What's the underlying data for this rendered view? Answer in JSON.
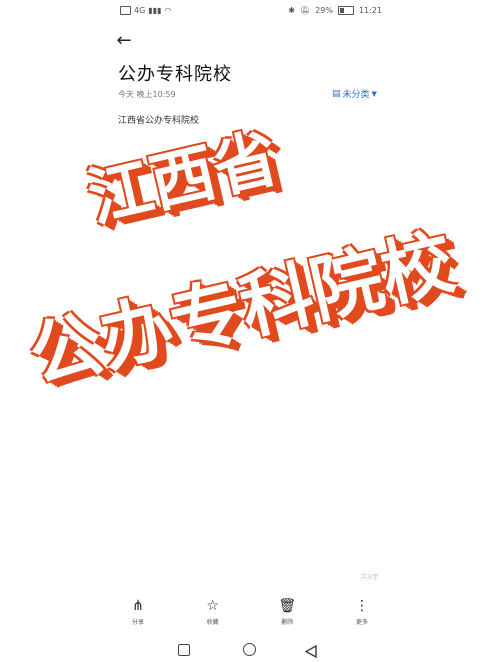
{
  "status_bar": {
    "left_icons": [
      "sim-icon",
      "signal-icon",
      "wifi-icon"
    ],
    "network": "4G",
    "battery_percent": "29%",
    "time": "11:21"
  },
  "header": {
    "title": "公办专科院校",
    "date": "今天 晚上10:59",
    "category": "未分类"
  },
  "note": {
    "body": "江西省公办专科院校"
  },
  "overlay": {
    "line1": "江西省",
    "line2": "公办专科院校"
  },
  "watermark": "共9字",
  "toolbar": {
    "share_label": "分享",
    "favorite_label": "收藏",
    "delete_label": "删除",
    "more_label": "更多"
  }
}
